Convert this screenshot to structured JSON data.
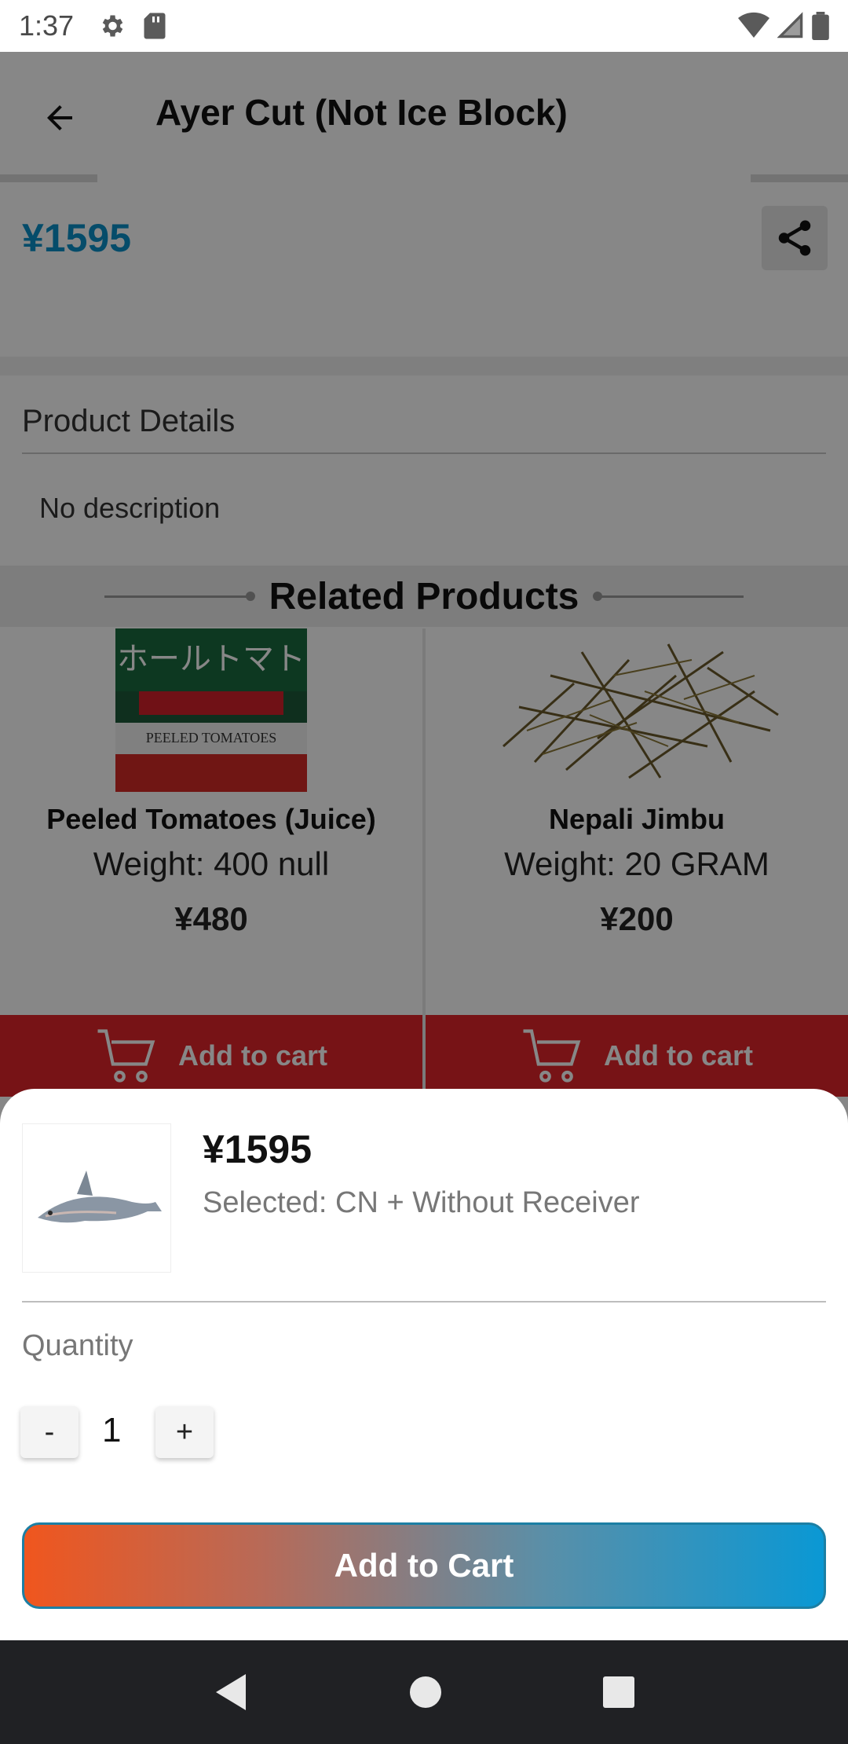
{
  "status_bar": {
    "time": "1:37"
  },
  "app_bar": {
    "title": "Ayer Cut (Not Ice Block)"
  },
  "product": {
    "price": "¥1595",
    "details_title": "Product Details",
    "description": "No description"
  },
  "related": {
    "title": "Related Products",
    "items": [
      {
        "name": "Peeled Tomatoes (Juice)",
        "weight": "Weight: 400 null",
        "price": "¥480",
        "cart_label": "Add to cart"
      },
      {
        "name": "Nepali Jimbu",
        "weight": "Weight: 20 GRAM",
        "price": "¥200",
        "cart_label": "Add to cart"
      }
    ]
  },
  "sheet": {
    "price": "¥1595",
    "selected": "Selected: CN + Without Receiver",
    "quantity_label": "Quantity",
    "minus_label": "-",
    "plus_label": "+",
    "quantity_value": "1",
    "add_button_label": "Add to Cart"
  },
  "colors": {
    "price_blue": "#0a90c8",
    "cart_red": "#e0242a",
    "gradient_start": "#f0561e",
    "gradient_end": "#0a98d4"
  },
  "icons": {
    "status": [
      "settings-icon",
      "sd-card-icon",
      "wifi-icon",
      "signal-icon",
      "battery-icon"
    ],
    "nav": [
      "back-triangle-icon",
      "home-circle-icon",
      "recents-square-icon"
    ]
  }
}
